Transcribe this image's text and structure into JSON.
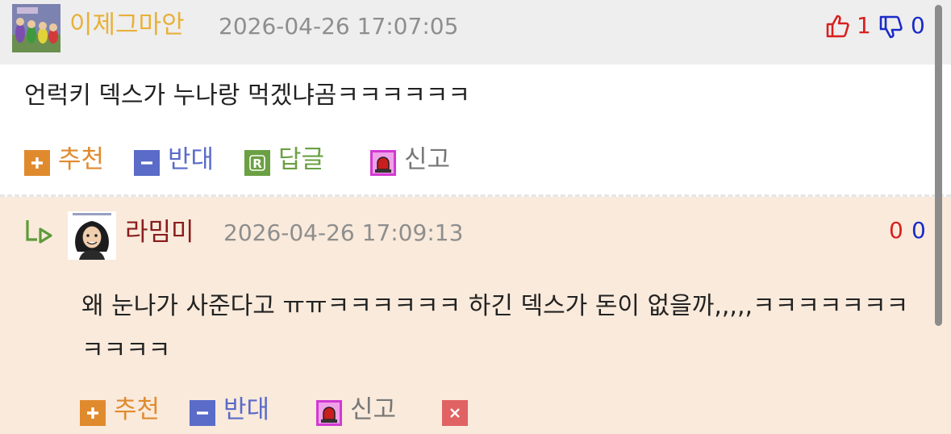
{
  "comments": [
    {
      "nickname": "이제그마안",
      "timestamp": "2026-04-26 17:07:05",
      "body": "언럭키 덱스가 누나랑 먹겠냐곰ㅋㅋㅋㅋㅋㅋ",
      "likes": "1",
      "dislikes": "0",
      "actions": {
        "recommend": "추천",
        "oppose": "반대",
        "reply": "답글",
        "report": "신고"
      }
    },
    {
      "nickname": "라밈미",
      "timestamp": "2026-04-26 17:09:13",
      "body": "왜 눈나가 사준다고 ㅠㅠㅋㅋㅋㅋㅋㅋ 하긴 덱스가 돈이 없을까,,,,,ㅋㅋㅋㅋㅋㅋㅋㅋㅋㅋㅋ",
      "likes": "0",
      "dislikes": "0",
      "actions": {
        "recommend": "추천",
        "oppose": "반대",
        "report": "신고"
      }
    }
  ],
  "colors": {
    "accent_orange": "#e08a2e",
    "accent_blue": "#5a6bc8",
    "accent_green": "#6ba043",
    "report_magenta": "#d23ad2",
    "delete_red": "#e06262",
    "like_red": "#d92020",
    "dislike_blue": "#1a2bc8"
  },
  "icons": [
    "avatar-teletubbies",
    "thumbs-up-icon",
    "thumbs-down-icon",
    "plus-icon",
    "minus-icon",
    "reply-r-icon",
    "siren-icon",
    "reply-arrow-icon",
    "avatar-cartoon-woman",
    "close-x-icon"
  ]
}
